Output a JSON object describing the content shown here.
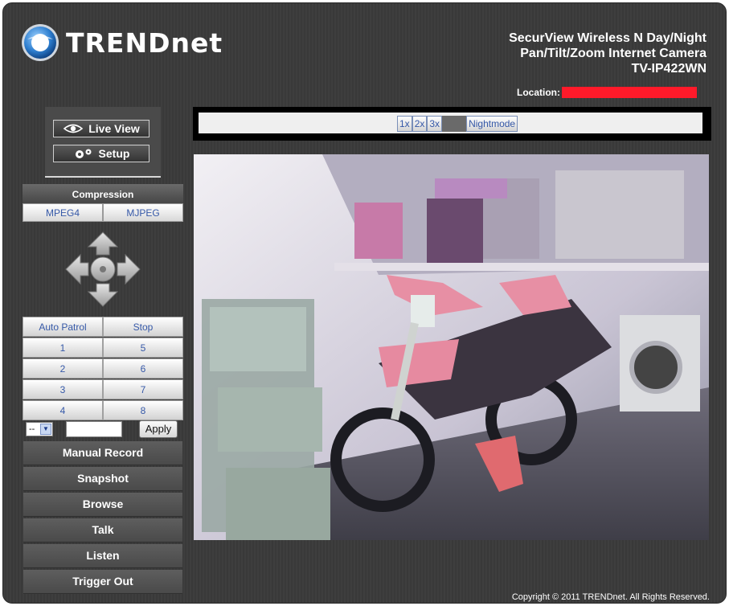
{
  "brand": {
    "name": "TRENDnet"
  },
  "header": {
    "product_line1": "SecurView Wireless N Day/Night",
    "product_line2": "Pan/Tilt/Zoom Internet Camera",
    "model": "TV-IP422WN",
    "location_label": "Location:",
    "location_value": ""
  },
  "mode": {
    "live_view": "Live View",
    "setup": "Setup"
  },
  "compression": {
    "title": "Compression",
    "options": [
      "MPEG4",
      "MJPEG"
    ]
  },
  "ptz": {
    "icons": [
      "arrow-up-icon",
      "arrow-down-icon",
      "arrow-left-icon",
      "arrow-right-icon",
      "home-icon"
    ]
  },
  "patrol": {
    "auto_patrol": "Auto Patrol",
    "stop": "Stop",
    "presets": [
      "1",
      "5",
      "2",
      "6",
      "3",
      "7",
      "4",
      "8"
    ]
  },
  "preset_control": {
    "select_value": "--",
    "input_value": "",
    "apply_label": "Apply"
  },
  "actions": [
    "Manual Record",
    "Snapshot",
    "Browse",
    "Talk",
    "Listen",
    "Trigger Out"
  ],
  "zoom": {
    "buttons": [
      "1x",
      "2x",
      "3x"
    ],
    "nightmode": "Nightmode"
  },
  "footer": {
    "copyright": "Copyright © 2011 TRENDnet. All Rights Reserved."
  },
  "colors": {
    "background": "#3c3c3c",
    "link_blue": "#3659a8",
    "location_redaction": "#ff1a2a"
  }
}
